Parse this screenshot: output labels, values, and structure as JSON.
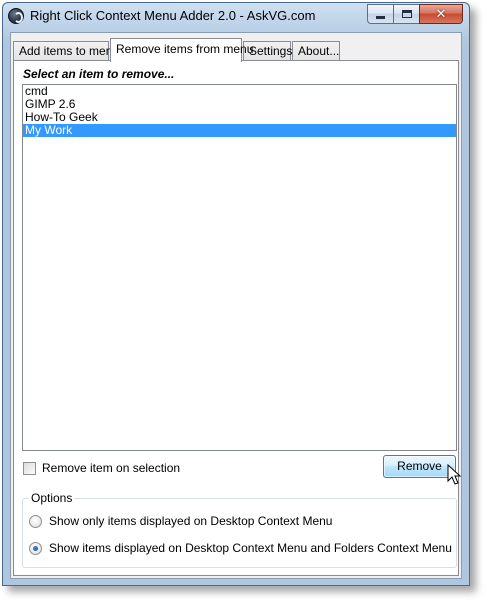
{
  "window": {
    "title": "Right Click Context Menu Adder 2.0  -  AskVG.com"
  },
  "tabs": [
    {
      "label": "Add items to menu"
    },
    {
      "label": "Remove items from menu"
    },
    {
      "label": "Settings"
    },
    {
      "label": "About..."
    }
  ],
  "active_tab": "Remove items from menu",
  "panel": {
    "prompt": "Select an item to remove...",
    "items": [
      {
        "label": "cmd",
        "selected": false
      },
      {
        "label": "GIMP 2.6",
        "selected": false
      },
      {
        "label": "How-To Geek",
        "selected": false
      },
      {
        "label": "My Work",
        "selected": true
      }
    ],
    "remove_on_selection_label": "Remove item on selection",
    "remove_on_selection_checked": false,
    "remove_button": "Remove"
  },
  "options": {
    "title": "Options",
    "radio1_label": "Show only items displayed on Desktop Context Menu",
    "radio1_checked": false,
    "radio2_label": "Show items displayed on Desktop Context Menu and Folders Context Menu",
    "radio2_checked": true
  },
  "colors": {
    "selection": "#3399ff",
    "title_bar": "#b9cfe6",
    "close_button": "#c74a32"
  }
}
